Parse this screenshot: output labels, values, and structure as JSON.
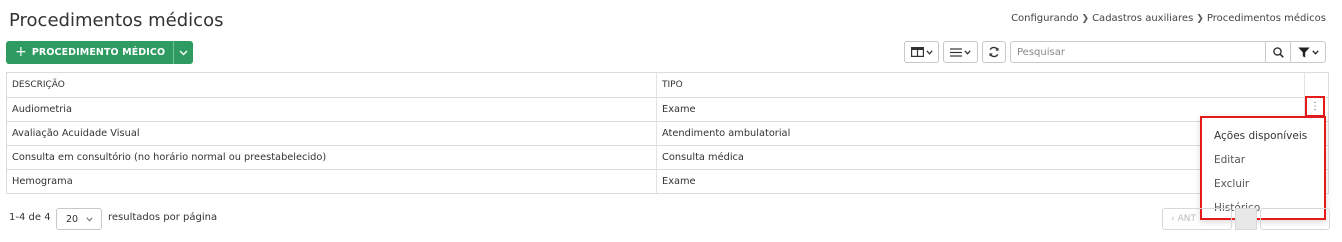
{
  "header": {
    "title": "Procedimentos médicos",
    "breadcrumb": [
      "Configurando",
      "Cadastros auxiliares",
      "Procedimentos médicos"
    ]
  },
  "toolbar": {
    "add_label": "PROCEDIMENTO MÉDICO",
    "search_placeholder": "Pesquisar",
    "icons": {
      "add": "plus-icon",
      "dropdown": "chevron-down-icon",
      "columns": "columns-icon",
      "density": "list-icon",
      "refresh": "refresh-icon",
      "search": "search-icon",
      "filter": "filter-icon"
    },
    "accent_color": "#2e9b61"
  },
  "table": {
    "columns": [
      "DESCRIÇÃO",
      "TIPO"
    ],
    "rows": [
      {
        "descricao": "Audiometria",
        "tipo": "Exame"
      },
      {
        "descricao": "Avaliação Acuidade Visual",
        "tipo": "Atendimento ambulatorial"
      },
      {
        "descricao": "Consulta em consultório (no horário normal ou preestabelecido)",
        "tipo": "Consulta médica"
      },
      {
        "descricao": "Hemograma",
        "tipo": "Exame"
      }
    ]
  },
  "actions_menu": {
    "title": "Ações disponíveis",
    "items": [
      "Editar",
      "Excluir",
      "Histórico"
    ],
    "highlight_color": "#e51b1b"
  },
  "footer": {
    "count": "1-4 de 4",
    "per_page": "20",
    "per_page_label": "resultados por página",
    "prev_label": "ANT"
  }
}
